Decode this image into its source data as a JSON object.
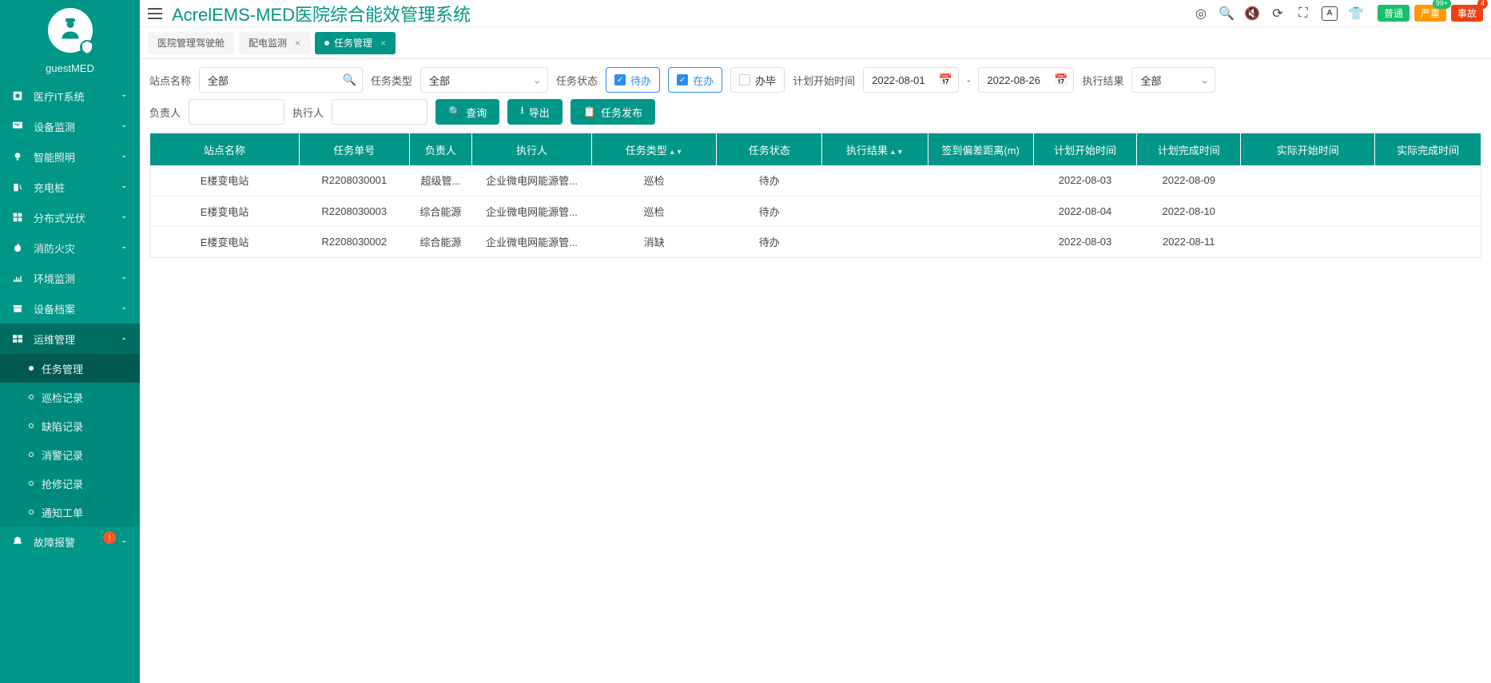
{
  "header": {
    "title": "AcrelEMS-MED医院综合能效管理系统",
    "badges": [
      {
        "label": "普通",
        "cls": "green",
        "count": ""
      },
      {
        "label": "严重",
        "cls": "orange",
        "count": "99+"
      },
      {
        "label": "事故",
        "cls": "red",
        "count": "4"
      }
    ]
  },
  "sidebar": {
    "username": "guestMED",
    "items": [
      {
        "label": "医疗IT系统",
        "icon": "hospital"
      },
      {
        "label": "设备监测",
        "icon": "monitor"
      },
      {
        "label": "智能照明",
        "icon": "bulb"
      },
      {
        "label": "充电桩",
        "icon": "charge"
      },
      {
        "label": "分布式光伏",
        "icon": "grid"
      },
      {
        "label": "消防火灾",
        "icon": "fire"
      },
      {
        "label": "环境监测",
        "icon": "env"
      },
      {
        "label": "设备档案",
        "icon": "archive"
      },
      {
        "label": "运维管理",
        "icon": "ops"
      },
      {
        "label": "故障报警",
        "icon": "alarm"
      }
    ],
    "submenu": [
      {
        "label": "任务管理"
      },
      {
        "label": "巡检记录"
      },
      {
        "label": "缺陷记录"
      },
      {
        "label": "消警记录"
      },
      {
        "label": "抢修记录"
      },
      {
        "label": "通知工单"
      }
    ]
  },
  "tabs": [
    {
      "label": "医院管理驾驶舱",
      "closable": false
    },
    {
      "label": "配电监测",
      "closable": true
    },
    {
      "label": "任务管理",
      "closable": true,
      "active": true
    }
  ],
  "filters": {
    "site_label": "站点名称",
    "site_value": "全部",
    "type_label": "任务类型",
    "type_value": "全部",
    "status_label": "任务状态",
    "status_pending": "待办",
    "status_doing": "在办",
    "status_done": "办毕",
    "plan_start_label": "计划开始时间",
    "date_from": "2022-08-01",
    "date_sep": "-",
    "date_to": "2022-08-26",
    "result_label": "执行结果",
    "result_value": "全部",
    "owner_label": "负责人",
    "executor_label": "执行人",
    "btn_query": "查询",
    "btn_export": "导出",
    "btn_publish": "任务发布"
  },
  "table": {
    "columns": [
      "站点名称",
      "任务单号",
      "负责人",
      "执行人",
      "任务类型",
      "任务状态",
      "执行结果",
      "签到偏差距离(m)",
      "计划开始时间",
      "计划完成时间",
      "实际开始时间",
      "实际完成时间"
    ],
    "widths": [
      155,
      115,
      65,
      125,
      130,
      110,
      110,
      110,
      108,
      108,
      140,
      110
    ],
    "rows": [
      {
        "c": [
          "E楼变电站",
          "R2208030001",
          "超级管...",
          "企业微电网能源管...",
          "巡检",
          "待办",
          "",
          "",
          "2022-08-03",
          "2022-08-09",
          "",
          ""
        ]
      },
      {
        "c": [
          "E楼变电站",
          "R2208030003",
          "综合能源",
          "企业微电网能源管...",
          "巡检",
          "待办",
          "",
          "",
          "2022-08-04",
          "2022-08-10",
          "",
          ""
        ]
      },
      {
        "c": [
          "E楼变电站",
          "R2208030002",
          "综合能源",
          "企业微电网能源管...",
          "消缺",
          "待办",
          "",
          "",
          "2022-08-03",
          "2022-08-11",
          "",
          ""
        ]
      }
    ]
  }
}
